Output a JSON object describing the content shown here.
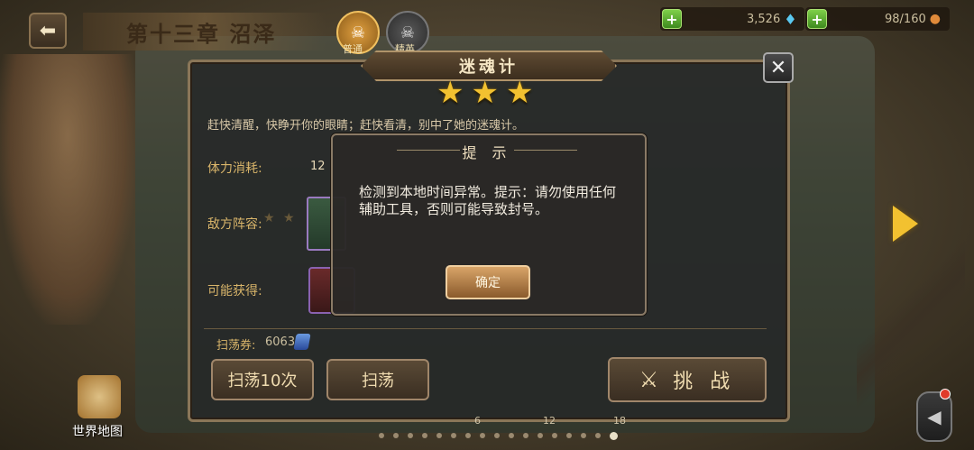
{
  "top_bar": {
    "chapter_title": "第十三章 沼泽",
    "mode_normal": "普通",
    "mode_elite": "精英",
    "diamonds": "3,526",
    "stamina": "98/160"
  },
  "stage": {
    "name": "迷魂计",
    "stars": 3,
    "description": "赶快清醒，快睁开你的眼睛；赶快看清，别中了她的迷魂计。",
    "stamina_label": "体力消耗:",
    "stamina_value": "12",
    "enemy_label": "敌方阵容:",
    "reward_label": "可能获得:",
    "ticket_label": "扫荡券:",
    "ticket_value": "6063",
    "sweep10_label": "扫荡10次",
    "sweep_label": "扫荡",
    "challenge_label": "挑 战"
  },
  "dialog": {
    "title": "提 示",
    "body": "检测到本地时间异常。提示：请勿使用任何辅助工具，否则可能导致封号。",
    "ok_label": "确定"
  },
  "map": {
    "world_map_label": "世界地图",
    "stage_numbers": [
      "6",
      "12",
      "18"
    ],
    "page_dots": 17,
    "active_dot": 16
  },
  "colors": {
    "star": "#f2c130",
    "accent_gold": "#d9b56a",
    "ok_button": "#d8a468",
    "plus_green": "#7fd04a"
  }
}
